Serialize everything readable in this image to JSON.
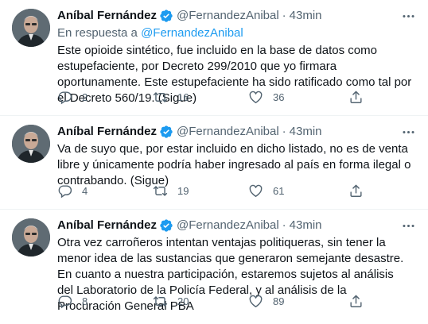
{
  "tweets": [
    {
      "name": "Aníbal Fernández",
      "handle": "@FernandezAnibal",
      "dot": "·",
      "time": "43min",
      "reply_prefix": "En respuesta a",
      "reply_mention": "@FernandezAnibal",
      "text": "Este opioide sintético, fue incluido en la base de datos como estupefaciente, por Decreto 299/2010 que yo firmara oportunamente. Este estupefaciente ha sido ratificado como tal por el Decreto 560/19. (Sigue)",
      "replies": "2",
      "retweets": "16",
      "likes": "36"
    },
    {
      "name": "Aníbal Fernández",
      "handle": "@FernandezAnibal",
      "dot": "·",
      "time": "43min",
      "text": "Va de suyo que, por estar incluido en dicho listado, no es de venta libre y únicamente podría haber ingresado al país en forma ilegal o contrabando. (Sigue)",
      "replies": "4",
      "retweets": "19",
      "likes": "61"
    },
    {
      "name": "Aníbal Fernández",
      "handle": "@FernandezAnibal",
      "dot": "·",
      "time": "43min",
      "text": "Otra vez carroñeros intentan ventajas politiqueras, sin tener la menor idea de las sustancias que generaron semejante desastre. En cuanto a nuestra participación, estaremos sujetos al análisis del Laboratorio de la Policía Federal, y al análisis de la Procuración General PBA",
      "replies": "8",
      "retweets": "20",
      "likes": "89"
    }
  ],
  "icons": {
    "verified": "verified-badge-icon",
    "more": "more-dots-icon",
    "reply": "reply-bubble-icon",
    "retweet": "retweet-arrows-icon",
    "like": "heart-icon",
    "share": "share-upload-icon"
  },
  "colors": {
    "accent": "#1d9bf0",
    "secondary_text": "#536471",
    "primary_text": "#0f1419",
    "divider": "#eff3f4"
  }
}
